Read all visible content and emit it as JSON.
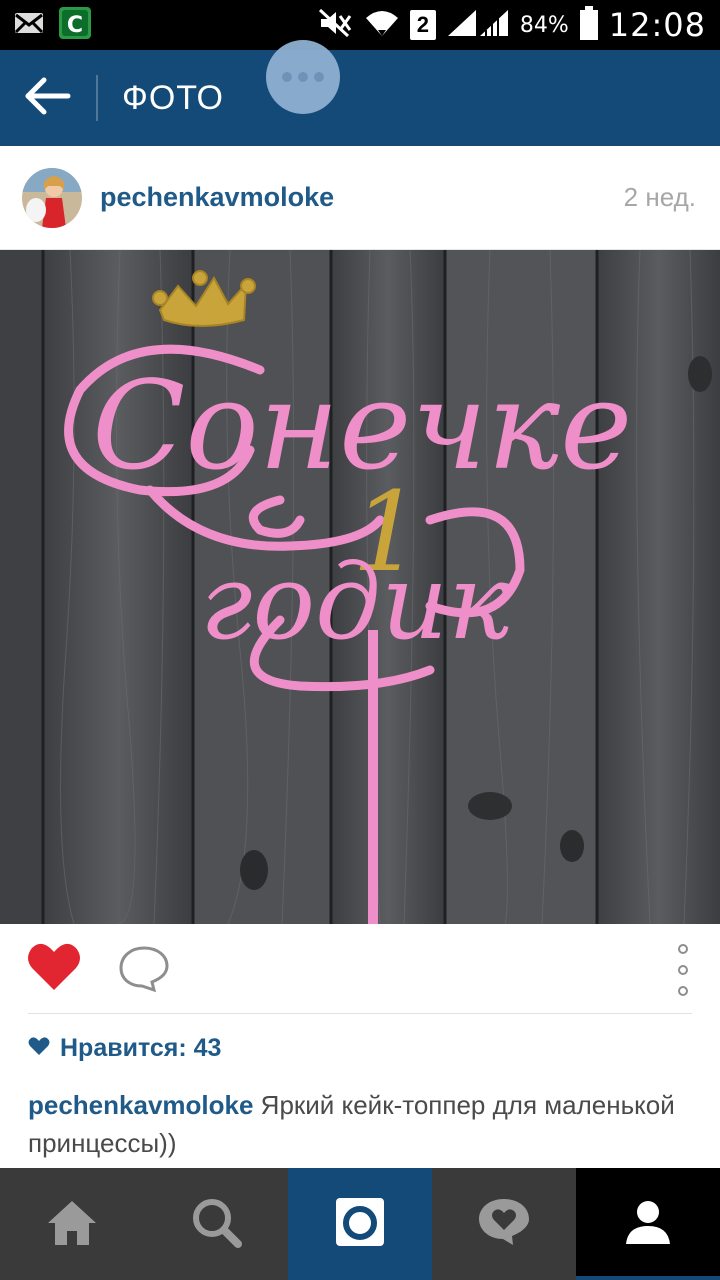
{
  "status_bar": {
    "sim_slot": "2",
    "battery": "84%",
    "time": "12:08"
  },
  "app_bar": {
    "title": "ФОТО"
  },
  "post": {
    "username": "pechenkavmoloke",
    "time_ago": "2 нед.",
    "photo_text": {
      "line1": "Сонечке",
      "number": "1",
      "line2": "годик"
    },
    "likes": "Нравится: 43",
    "caption_user": "pechenkavmoloke",
    "caption_text": " Яркий кейк-топпер для маленькой принцессы))"
  },
  "colors": {
    "app_bar": "#134a78",
    "link": "#1f5a88",
    "heart": "#e12631",
    "topper_pink": "#ef8fc9",
    "topper_gold": "#c9a43a"
  },
  "bottom_nav": {
    "items": [
      "home-icon",
      "search-icon",
      "camera-icon",
      "activity-icon",
      "profile-icon"
    ],
    "active": "camera-icon"
  }
}
